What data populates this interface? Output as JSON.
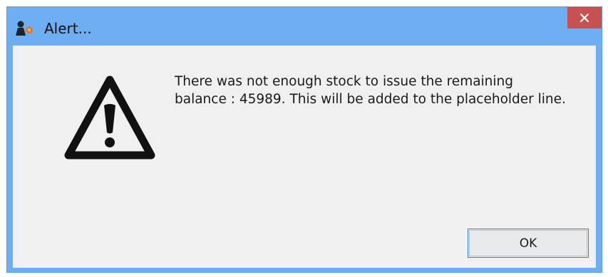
{
  "window": {
    "title": "Alert...",
    "app_icon": "app-logo-icon",
    "close_icon": "close-icon",
    "title_bar_color": "#6eaef2",
    "close_button_color": "#c7514f"
  },
  "alert": {
    "icon": "warning-icon",
    "message_line1": "There was not enough stock to issue the remaining",
    "message_line2": "balance : 45989. This will be added to the placeholder line."
  },
  "buttons": {
    "ok_label": "OK"
  }
}
